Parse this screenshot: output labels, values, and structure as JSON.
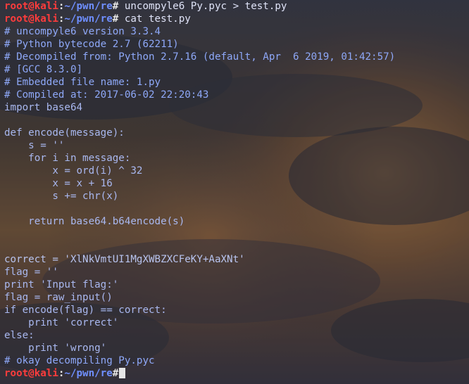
{
  "prompt": {
    "user_host": "root@kali",
    "separator": ":",
    "path": "~/pwn/re",
    "symbol": "#"
  },
  "commands": [
    " uncompyle6 Py.pyc > test.py",
    " cat test.py",
    ""
  ],
  "output_lines": [
    {
      "text": "# uncompyle6 version 3.3.4",
      "kind": "comment"
    },
    {
      "text": "# Python bytecode 2.7 (62211)",
      "kind": "comment"
    },
    {
      "text": "# Decompiled from: Python 2.7.16 (default, Apr  6 2019, 01:42:57)",
      "kind": "comment"
    },
    {
      "text": "# [GCC 8.3.0]",
      "kind": "comment"
    },
    {
      "text": "# Embedded file name: 1.py",
      "kind": "comment"
    },
    {
      "text": "# Compiled at: 2017-06-02 22:20:43",
      "kind": "comment"
    },
    {
      "text": "import base64",
      "kind": "code"
    },
    {
      "text": "",
      "kind": "code"
    },
    {
      "text": "def encode(message):",
      "kind": "code"
    },
    {
      "text": "    s = ''",
      "kind": "code"
    },
    {
      "text": "    for i in message:",
      "kind": "code"
    },
    {
      "text": "        x = ord(i) ^ 32",
      "kind": "code"
    },
    {
      "text": "        x = x + 16",
      "kind": "code"
    },
    {
      "text": "        s += chr(x)",
      "kind": "code"
    },
    {
      "text": "",
      "kind": "code"
    },
    {
      "text": "    return base64.b64encode(s)",
      "kind": "code"
    },
    {
      "text": "",
      "kind": "code"
    },
    {
      "text": "",
      "kind": "code"
    },
    {
      "text": "correct = 'XlNkVmtUI1MgXWBZXCFeKY+AaXNt'",
      "kind": "code"
    },
    {
      "text": "flag = ''",
      "kind": "code"
    },
    {
      "text": "print 'Input flag:'",
      "kind": "code"
    },
    {
      "text": "flag = raw_input()",
      "kind": "code"
    },
    {
      "text": "if encode(flag) == correct:",
      "kind": "code"
    },
    {
      "text": "    print 'correct'",
      "kind": "code"
    },
    {
      "text": "else:",
      "kind": "code"
    },
    {
      "text": "    print 'wrong'",
      "kind": "code"
    },
    {
      "text": "# okay decompiling Py.pyc",
      "kind": "comment"
    }
  ],
  "colors": {
    "prompt_user": "#ff3c3c",
    "prompt_path": "#6f8fff",
    "text": "#a9b8f0",
    "background": "#2a2c36"
  }
}
